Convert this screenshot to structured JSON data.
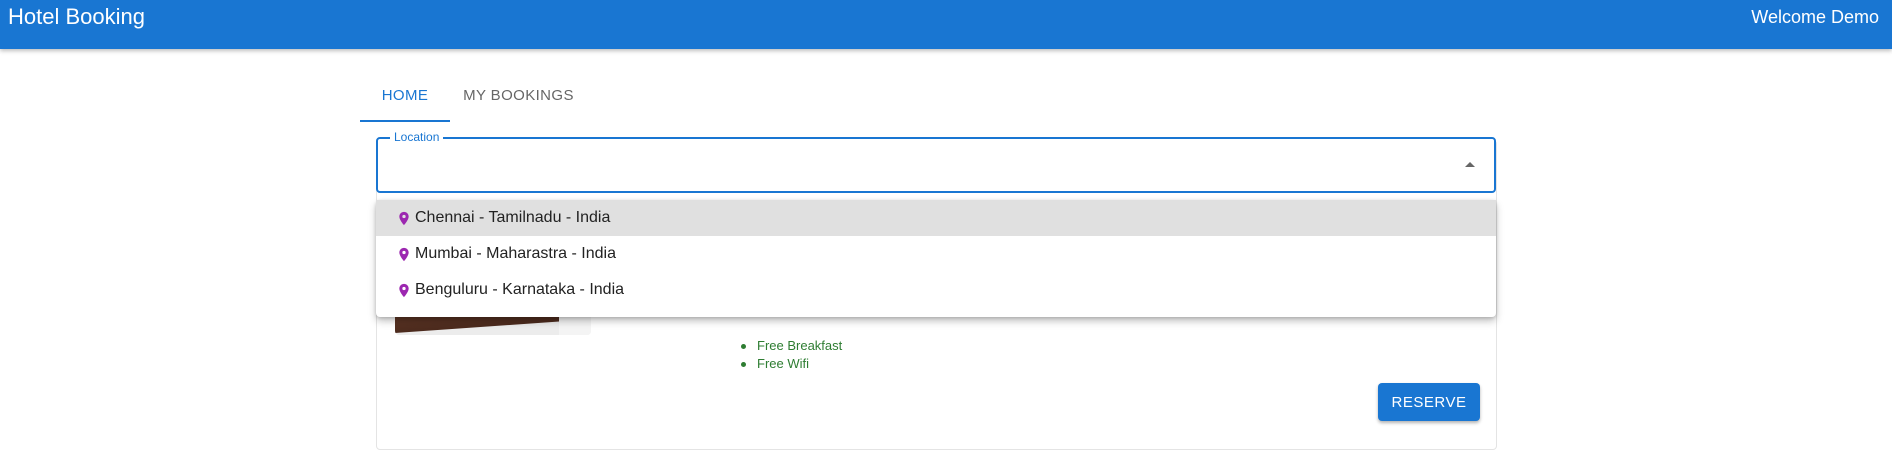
{
  "app": {
    "title": "Hotel Booking",
    "welcome": "Welcome Demo",
    "colors": {
      "primary": "#1976d2",
      "pin": "#9c27b0",
      "amenity": "#2e7d32",
      "highlight": "#e0e0e0"
    }
  },
  "tabs": [
    {
      "label": "HOME",
      "selected": true
    },
    {
      "label": "MY BOOKINGS",
      "selected": false
    }
  ],
  "location": {
    "label": "Location",
    "value": "",
    "placeholder": "",
    "icon": "caret-up-icon",
    "options": [
      {
        "label": "Chennai - Tamilnadu - India",
        "icon": "location-pin-icon",
        "highlighted": true
      },
      {
        "label": "Mumbai - Maharastra - India",
        "icon": "location-pin-icon",
        "highlighted": false
      },
      {
        "label": "Benguluru - Karnataka - India",
        "icon": "location-pin-icon",
        "highlighted": false
      }
    ]
  },
  "hotel_card": {
    "amenities": [
      "Free Breakfast",
      "Free Wifi"
    ],
    "reserve_label": "RESERVE"
  }
}
